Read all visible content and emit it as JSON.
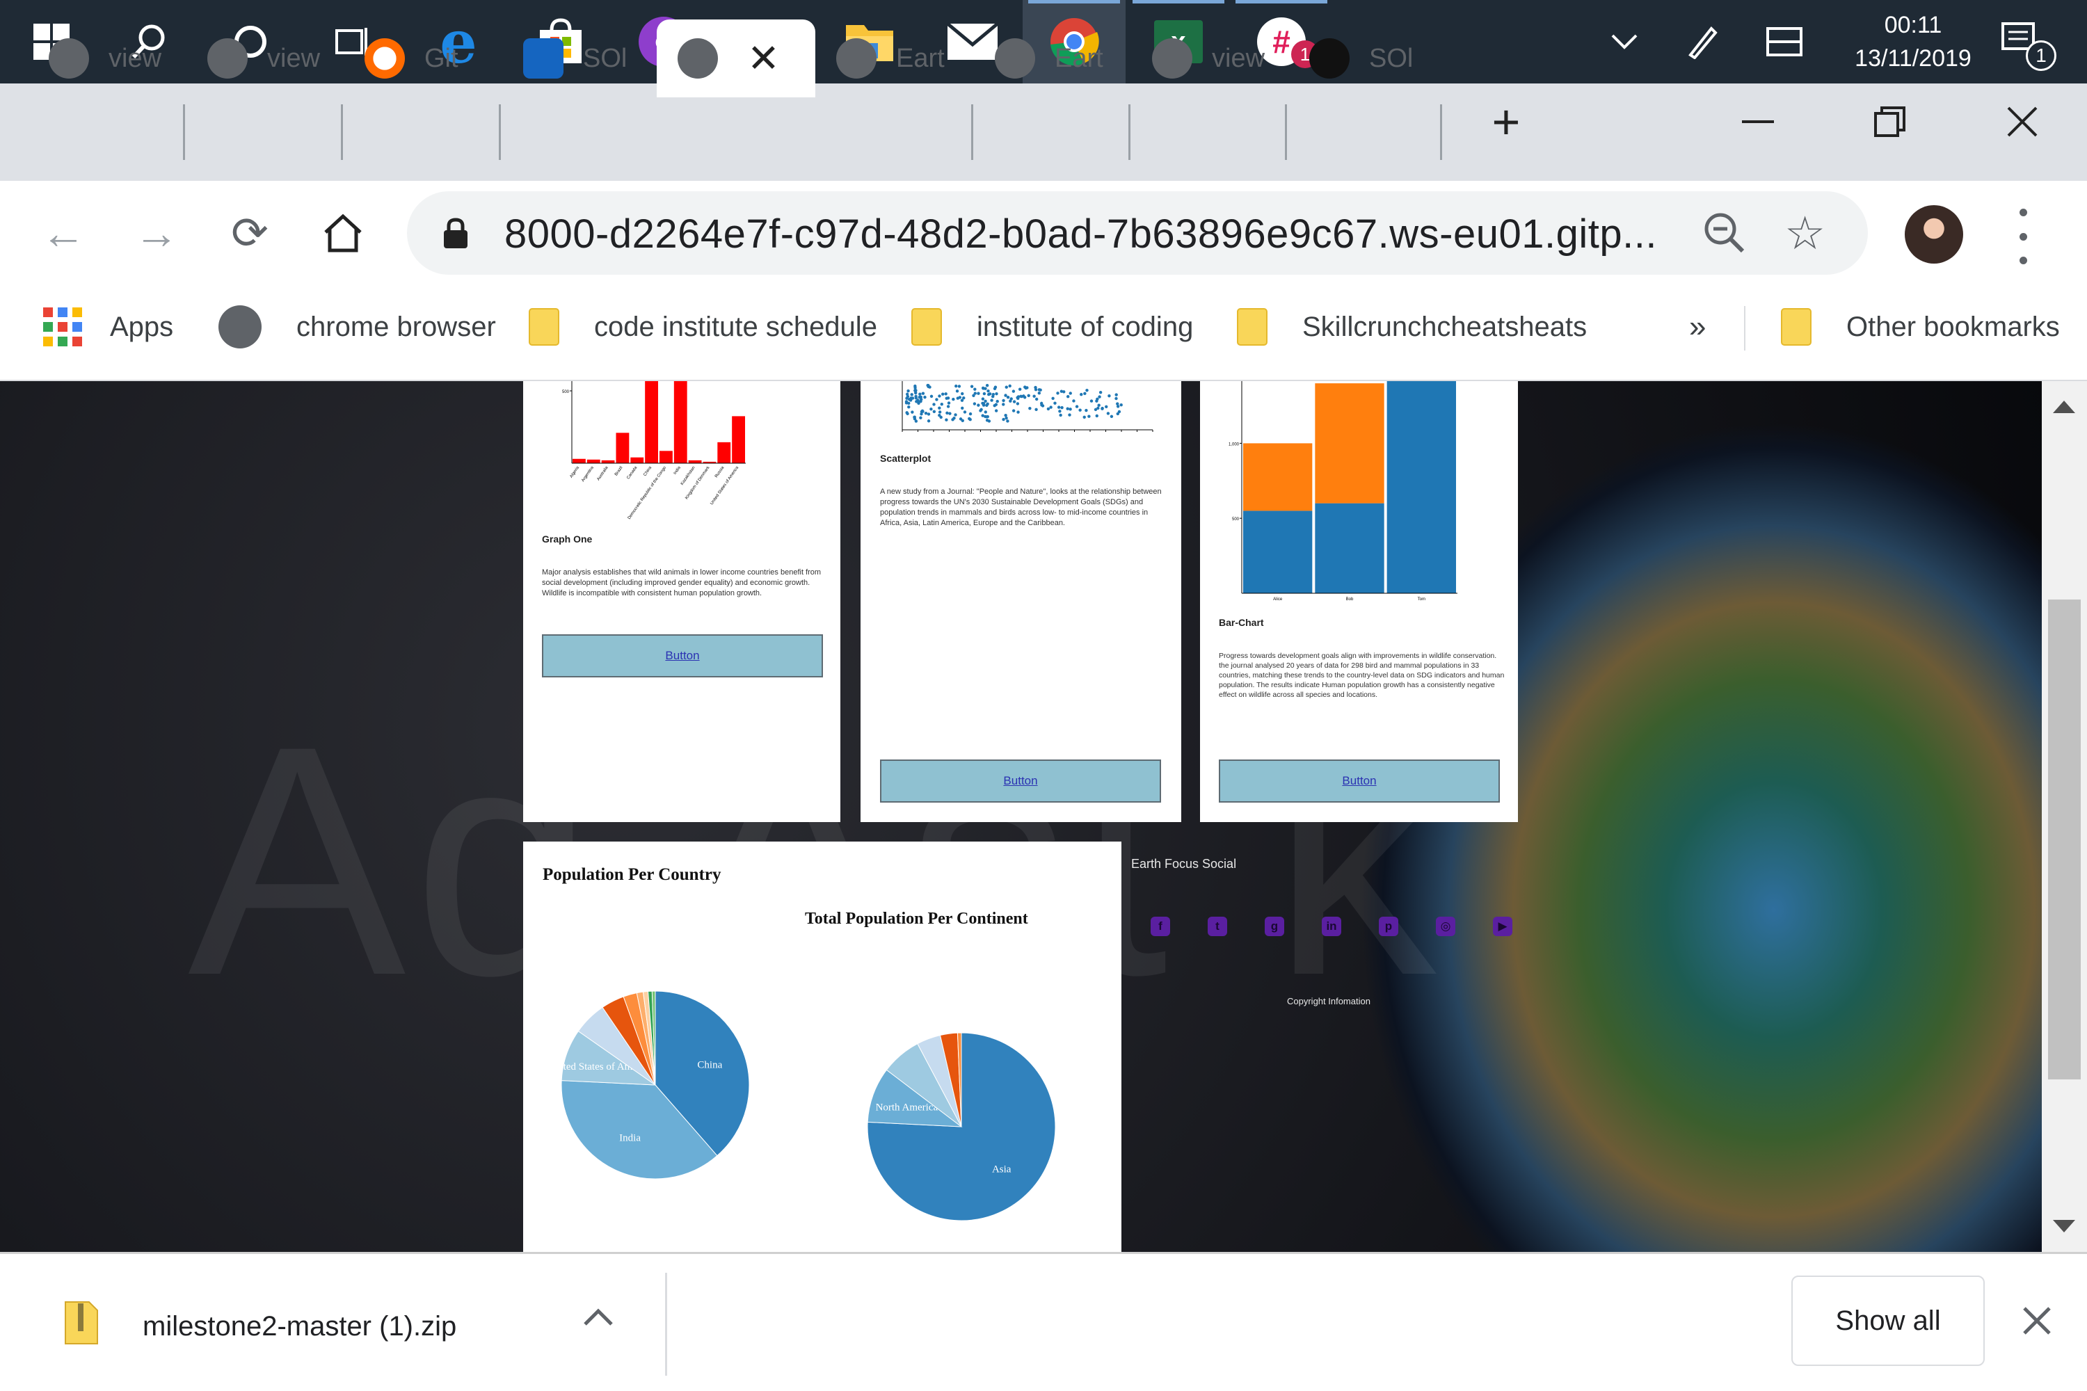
{
  "taskbar": {
    "time": "00:11",
    "date": "13/11/2019",
    "notification_count": "1",
    "slack_badge": "1",
    "apps": [
      "start-icon",
      "search-icon",
      "cortana-icon",
      "task-view-icon",
      "edge-icon",
      "store-icon",
      "github-desktop-icon",
      "whiteboard-icon",
      "file-explorer-icon",
      "mail-icon",
      "chrome-icon",
      "excel-icon",
      "slack-icon"
    ]
  },
  "tabs": [
    {
      "label": "view",
      "icon": "globe-icon"
    },
    {
      "label": "view",
      "icon": "globe-icon"
    },
    {
      "label": "Git",
      "icon": "gitpod-icon"
    },
    {
      "label": "SOl",
      "icon": "codeinstitute-icon"
    },
    {
      "label": "",
      "icon": "globe-icon",
      "active": true
    },
    {
      "label": "Eart",
      "icon": "globe-icon"
    },
    {
      "label": "Eart",
      "icon": "globe-icon"
    },
    {
      "label": "view",
      "icon": "globe-icon"
    },
    {
      "label": "SOl",
      "icon": "github-icon"
    }
  ],
  "address_bar": {
    "url": "8000-d2264e7f-c97d-48d2-b0ad-7b63896e9c67.ws-eu01.gitp..."
  },
  "bookmarks": {
    "apps": "Apps",
    "items": [
      "chrome browser",
      "code institute schedule",
      "institute of coding",
      "Skillcrunchcheatsheats"
    ],
    "overflow": "»",
    "other": "Other bookmarks"
  },
  "page": {
    "watermark": "Ad  Ast  k",
    "cards": [
      {
        "title": "Graph One",
        "text": "Major analysis establishes that wild animals in lower income countries benefit from social development (including improved gender equality) and economic growth. Wildlife is incompatible with consistent human population growth.",
        "button": "Button"
      },
      {
        "title": "Scatterplot",
        "text": "A new study from a Journal: \"People and Nature\", looks at the relationship between progress towards the UN's 2030 Sustainable Development Goals (SDGs) and population trends in mammals and birds across low- to mid-income countries in Africa, Asia, Latin America, Europe and the Caribbean.",
        "button": "Button"
      },
      {
        "title": "Bar-Chart",
        "text": "Progress towards development goals align with improvements in wildlife conservation. the journal analysed 20 years of data for 298 bird and mammal populations in 33 countries, matching these trends to the country-level data on SDG indicators and human population. The results indicate Human population growth has a consistently negative effect on wildlife across all species and locations.",
        "button": "Button"
      }
    ],
    "pie_section_title": "Population Per Country",
    "pie2_title": "Total Population Per Continent",
    "footer": {
      "social_title": "Earth Focus Social",
      "icons": [
        "facebook-icon",
        "twitter-icon",
        "github-icon",
        "linkedin-icon",
        "pinterest-icon",
        "instagram-icon",
        "youtube-icon"
      ],
      "copyright": "Copyright Infomation"
    }
  },
  "chart_data": [
    {
      "type": "bar",
      "title": "",
      "categories": [
        "Algeria",
        "Argentina",
        "Australia",
        "Brazil",
        "Canada",
        "China",
        "Democratic Republic of the Congo",
        "India",
        "Kazakhstan",
        "Kingdom of Denmark",
        "Russia",
        "United States of America"
      ],
      "values": [
        30,
        25,
        20,
        210,
        40,
        1400,
        85,
        1350,
        20,
        10,
        145,
        325
      ],
      "ylim": [
        0,
        1000
      ],
      "yticks": [
        "500",
        "1,000"
      ],
      "color": "#ff0000"
    },
    {
      "type": "scatter",
      "title": "",
      "xlim": [
        0,
        100
      ],
      "ylim": [
        0,
        100000
      ],
      "color": "#1f77b4",
      "points_note": "dense cluster of points in upper band"
    },
    {
      "type": "bar",
      "title": "",
      "categories": [
        "Alice",
        "Bob",
        "Tom"
      ],
      "series": [
        {
          "values": [
            550,
            600,
            1700
          ],
          "color": "#1f77b4"
        },
        {
          "values": [
            450,
            800,
            0
          ],
          "color": "#ff7f0e"
        }
      ],
      "stacked": true,
      "ylim": [
        0,
        1600
      ],
      "yticks": [
        "500",
        "1,000",
        "1,500"
      ]
    },
    {
      "type": "pie",
      "title": "Population Per Country",
      "labels": [
        "China",
        "India",
        "United States of America",
        "",
        "",
        "",
        "",
        "",
        "",
        ""
      ],
      "values": [
        1400,
        1350,
        325,
        210,
        145,
        85,
        40,
        30,
        25,
        20
      ],
      "colors": [
        "#3182bd",
        "#6baed6",
        "#9ecae1",
        "#c6dbef",
        "#e6550d",
        "#fd8d3c",
        "#fdae6b",
        "#fdd0a2",
        "#31a354",
        "#74c476"
      ]
    },
    {
      "type": "pie",
      "title": "Total Population Per Continent",
      "labels": [
        "Asia",
        "North America",
        "",
        "",
        "",
        ""
      ],
      "values": [
        4600,
        580,
        420,
        250,
        180,
        40
      ],
      "colors": [
        "#3182bd",
        "#6baed6",
        "#9ecae1",
        "#c6dbef",
        "#e6550d",
        "#fd8d3c"
      ]
    }
  ],
  "downloads": {
    "file": "milestone2-master (1).zip",
    "show_all": "Show all"
  }
}
